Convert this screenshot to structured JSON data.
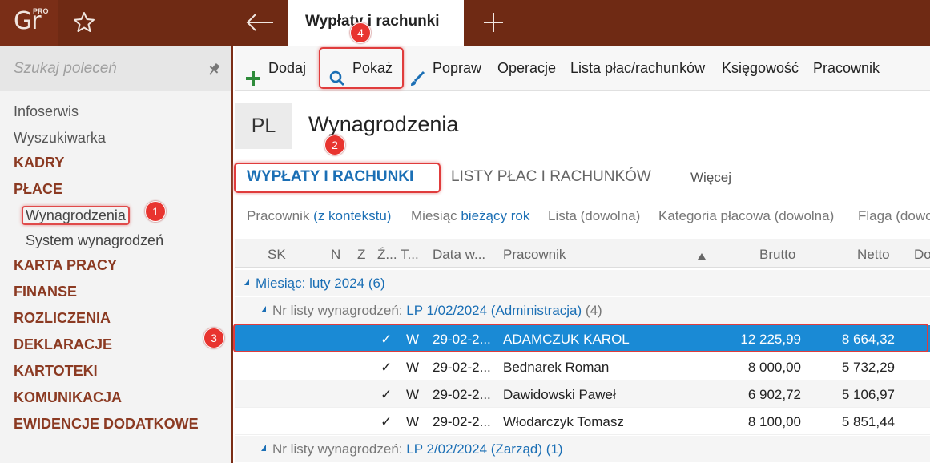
{
  "app": {
    "logo_text": "Gr",
    "logo_sup": "PRO",
    "active_tab": "Wypłaty i rachunki"
  },
  "sidebar": {
    "search_placeholder": "Szukaj poleceń",
    "items": [
      {
        "label": "Infoserwis",
        "type": "plain"
      },
      {
        "label": "Wyszukiwarka",
        "type": "plain"
      },
      {
        "label": "KADRY",
        "type": "section"
      },
      {
        "label": "PŁACE",
        "type": "section"
      },
      {
        "label": "Wynagrodzenia",
        "type": "sub"
      },
      {
        "label": "System wynagrodzeń",
        "type": "sub"
      },
      {
        "label": "KARTA PRACY",
        "type": "section"
      },
      {
        "label": "FINANSE",
        "type": "section"
      },
      {
        "label": "ROZLICZENIA",
        "type": "section"
      },
      {
        "label": "DEKLARACJE",
        "type": "section"
      },
      {
        "label": "KARTOTEKI",
        "type": "section"
      },
      {
        "label": "KOMUNIKACJA",
        "type": "section"
      },
      {
        "label": "EWIDENCJE DODATKOWE",
        "type": "section"
      }
    ]
  },
  "toolbar": {
    "add": "Dodaj",
    "show": "Pokaż",
    "edit": "Popraw",
    "operations": "Operacje",
    "payroll_list": "Lista płac/rachunków",
    "accounting": "Księgowość",
    "employee": "Pracownik"
  },
  "page": {
    "badge": "PL",
    "title": "Wynagrodzenia"
  },
  "subtabs": {
    "active": "WYPŁATY I RACHUNKI",
    "inactive": "LISTY PŁAC I RACHUNKÓW",
    "more": "Więcej"
  },
  "filters": {
    "employee_label": "Pracownik",
    "employee_value": "(z kontekstu)",
    "month_label": "Miesiąc",
    "month_value": "bieżący rok",
    "list": "Lista (dowolna)",
    "category": "Kategoria płacowa (dowolna)",
    "flag": "Flaga (dowolna)"
  },
  "grid": {
    "columns": {
      "sk": "SK",
      "n": "N",
      "z": "Z",
      "z2": "Ź...",
      "t": "T...",
      "date": "Data w...",
      "employee": "Pracownik",
      "gross": "Brutto",
      "net": "Netto",
      "next": "Do"
    },
    "group_month_label": "Miesiąc:",
    "group_month_value": "luty 2024",
    "group_month_count": "(6)",
    "group1_label": "Nr listy wynagrodzeń:",
    "group1_value": "LP 1/02/2024 (Administracja)",
    "group1_count": "(4)",
    "group2_label": "Nr listy wynagrodzeń:",
    "group2_value": "LP 2/02/2024 (Zarząd)",
    "group2_count": "(1)",
    "rows": [
      {
        "check": "✓",
        "type": "W",
        "date": "29-02-2...",
        "name": "ADAMCZUK KAROL",
        "gross": "12 225,99",
        "net": "8 664,32"
      },
      {
        "check": "✓",
        "type": "W",
        "date": "29-02-2...",
        "name": "Bednarek Roman",
        "gross": "8 000,00",
        "net": "5 732,29"
      },
      {
        "check": "✓",
        "type": "W",
        "date": "29-02-2...",
        "name": "Dawidowski Paweł",
        "gross": "6 902,72",
        "net": "5 106,97"
      },
      {
        "check": "✓",
        "type": "W",
        "date": "29-02-2...",
        "name": "Włodarczyk Tomasz",
        "gross": "8 100,00",
        "net": "5 851,44"
      }
    ]
  },
  "markers": {
    "m1": "1",
    "m2": "2",
    "m3": "3",
    "m4": "4"
  },
  "colors": {
    "brand": "#6f2a14",
    "accent": "#1b6fb5",
    "selection": "#1a8ad5",
    "highlight": "#e03c3c"
  }
}
